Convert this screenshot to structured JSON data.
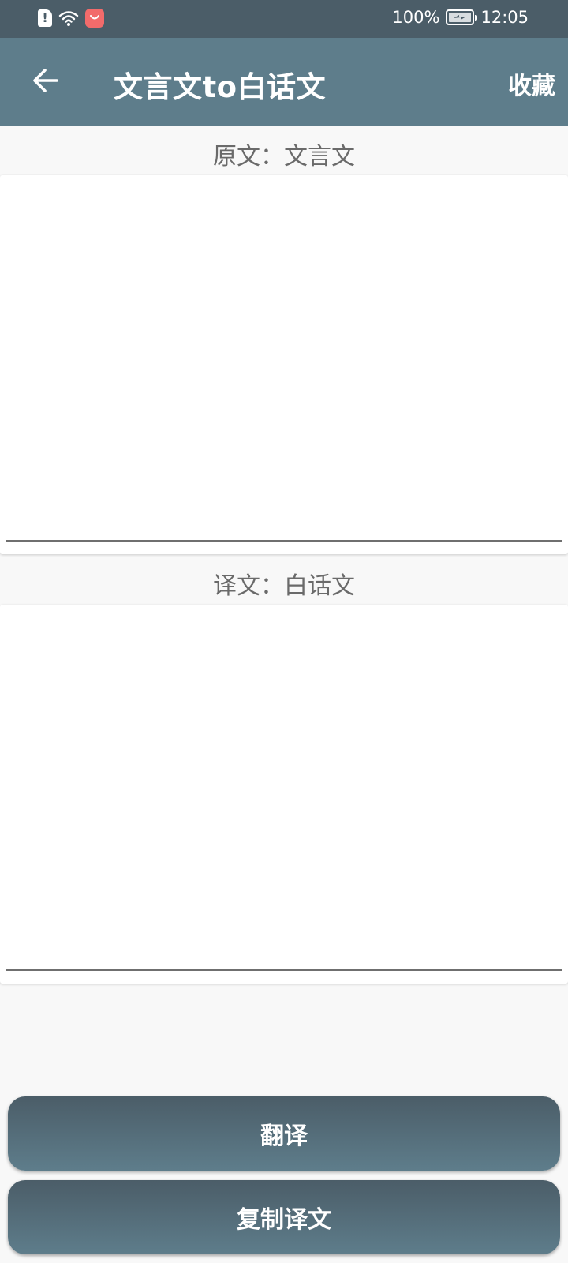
{
  "status_bar": {
    "battery": "100%",
    "time": "12:05",
    "icons": [
      "sim-alert-icon",
      "wifi-icon",
      "app-store-icon",
      "battery-charging-icon"
    ]
  },
  "app_bar": {
    "back_icon": "arrow-left-icon",
    "title": "文言文to白话文",
    "favorite_label": "收藏"
  },
  "source": {
    "label": "原文：文言文",
    "value": ""
  },
  "translation": {
    "label": "译文：白话文",
    "value": ""
  },
  "actions": {
    "translate_label": "翻译",
    "copy_label": "复制译文"
  },
  "colors": {
    "status_bar": "#4b5d68",
    "app_bar": "#5e7d8b",
    "background": "#f8f8f8",
    "button_gradient_top": "#4b5d68",
    "button_gradient_bottom": "#5e7d8b",
    "store_icon": "#f26b6b"
  }
}
